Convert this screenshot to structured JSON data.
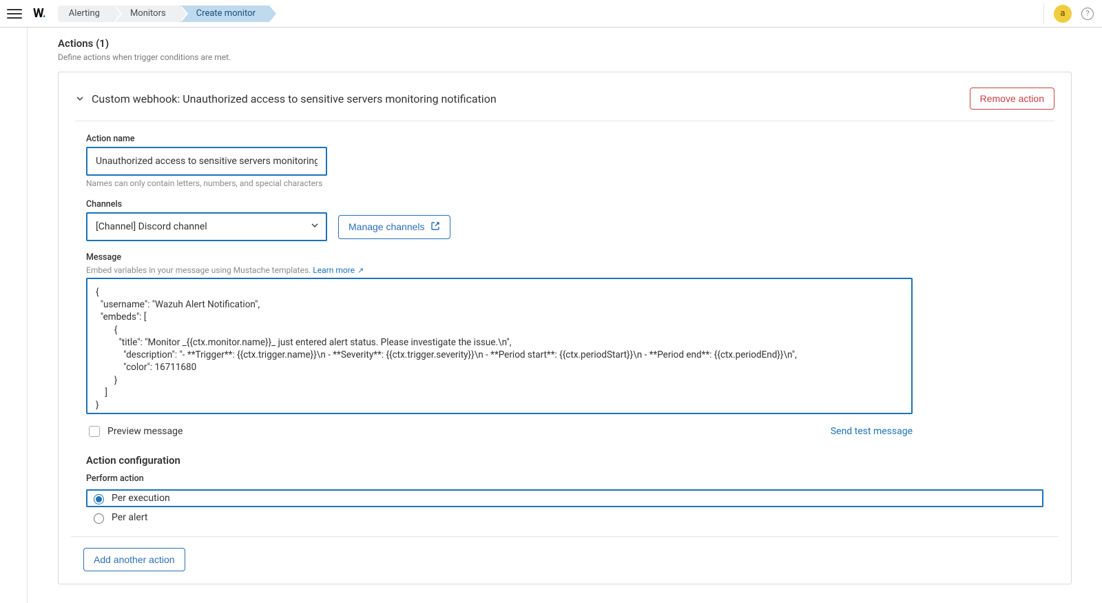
{
  "topbar": {
    "breadcrumbs": [
      "Alerting",
      "Monitors",
      "Create monitor"
    ],
    "avatar_initial": "a"
  },
  "section": {
    "title": "Actions (1)",
    "subtitle": "Define actions when trigger conditions are met."
  },
  "action": {
    "header_title": "Custom webhook: Unauthorized access to sensitive servers monitoring notification",
    "remove_label": "Remove action",
    "name_label": "Action name",
    "name_value": "Unauthorized access to sensitive servers monitoring notification",
    "name_help": "Names can only contain letters, numbers, and special characters",
    "channels_label": "Channels",
    "channels_selected": "[Channel] Discord channel",
    "manage_channels_label": "Manage channels",
    "message_label": "Message",
    "message_help_prefix": "Embed variables in your message using Mustache templates. ",
    "message_learn_more": "Learn more",
    "message_value": "{\n  \"username\": \"Wazuh Alert Notification\",\n  \"embeds\": [\n        {\n          \"title\": \"Monitor _{{ctx.monitor.name}}_ just entered alert status. Please investigate the issue.\\n\",\n            \"description\": \"- **Trigger**: {{ctx.trigger.name}}\\n - **Severity**: {{ctx.trigger.severity}}\\n - **Period start**: {{ctx.periodStart}}\\n - **Period end**: {{ctx.periodEnd}}\\n\",\n            \"color\": 16711680\n        }\n    ]\n}",
    "preview_label": "Preview message",
    "send_test_label": "Send test message",
    "config_heading": "Action configuration",
    "perform_label": "Perform action",
    "radio_per_execution": "Per execution",
    "radio_per_alert": "Per alert",
    "add_another_label": "Add another action"
  }
}
